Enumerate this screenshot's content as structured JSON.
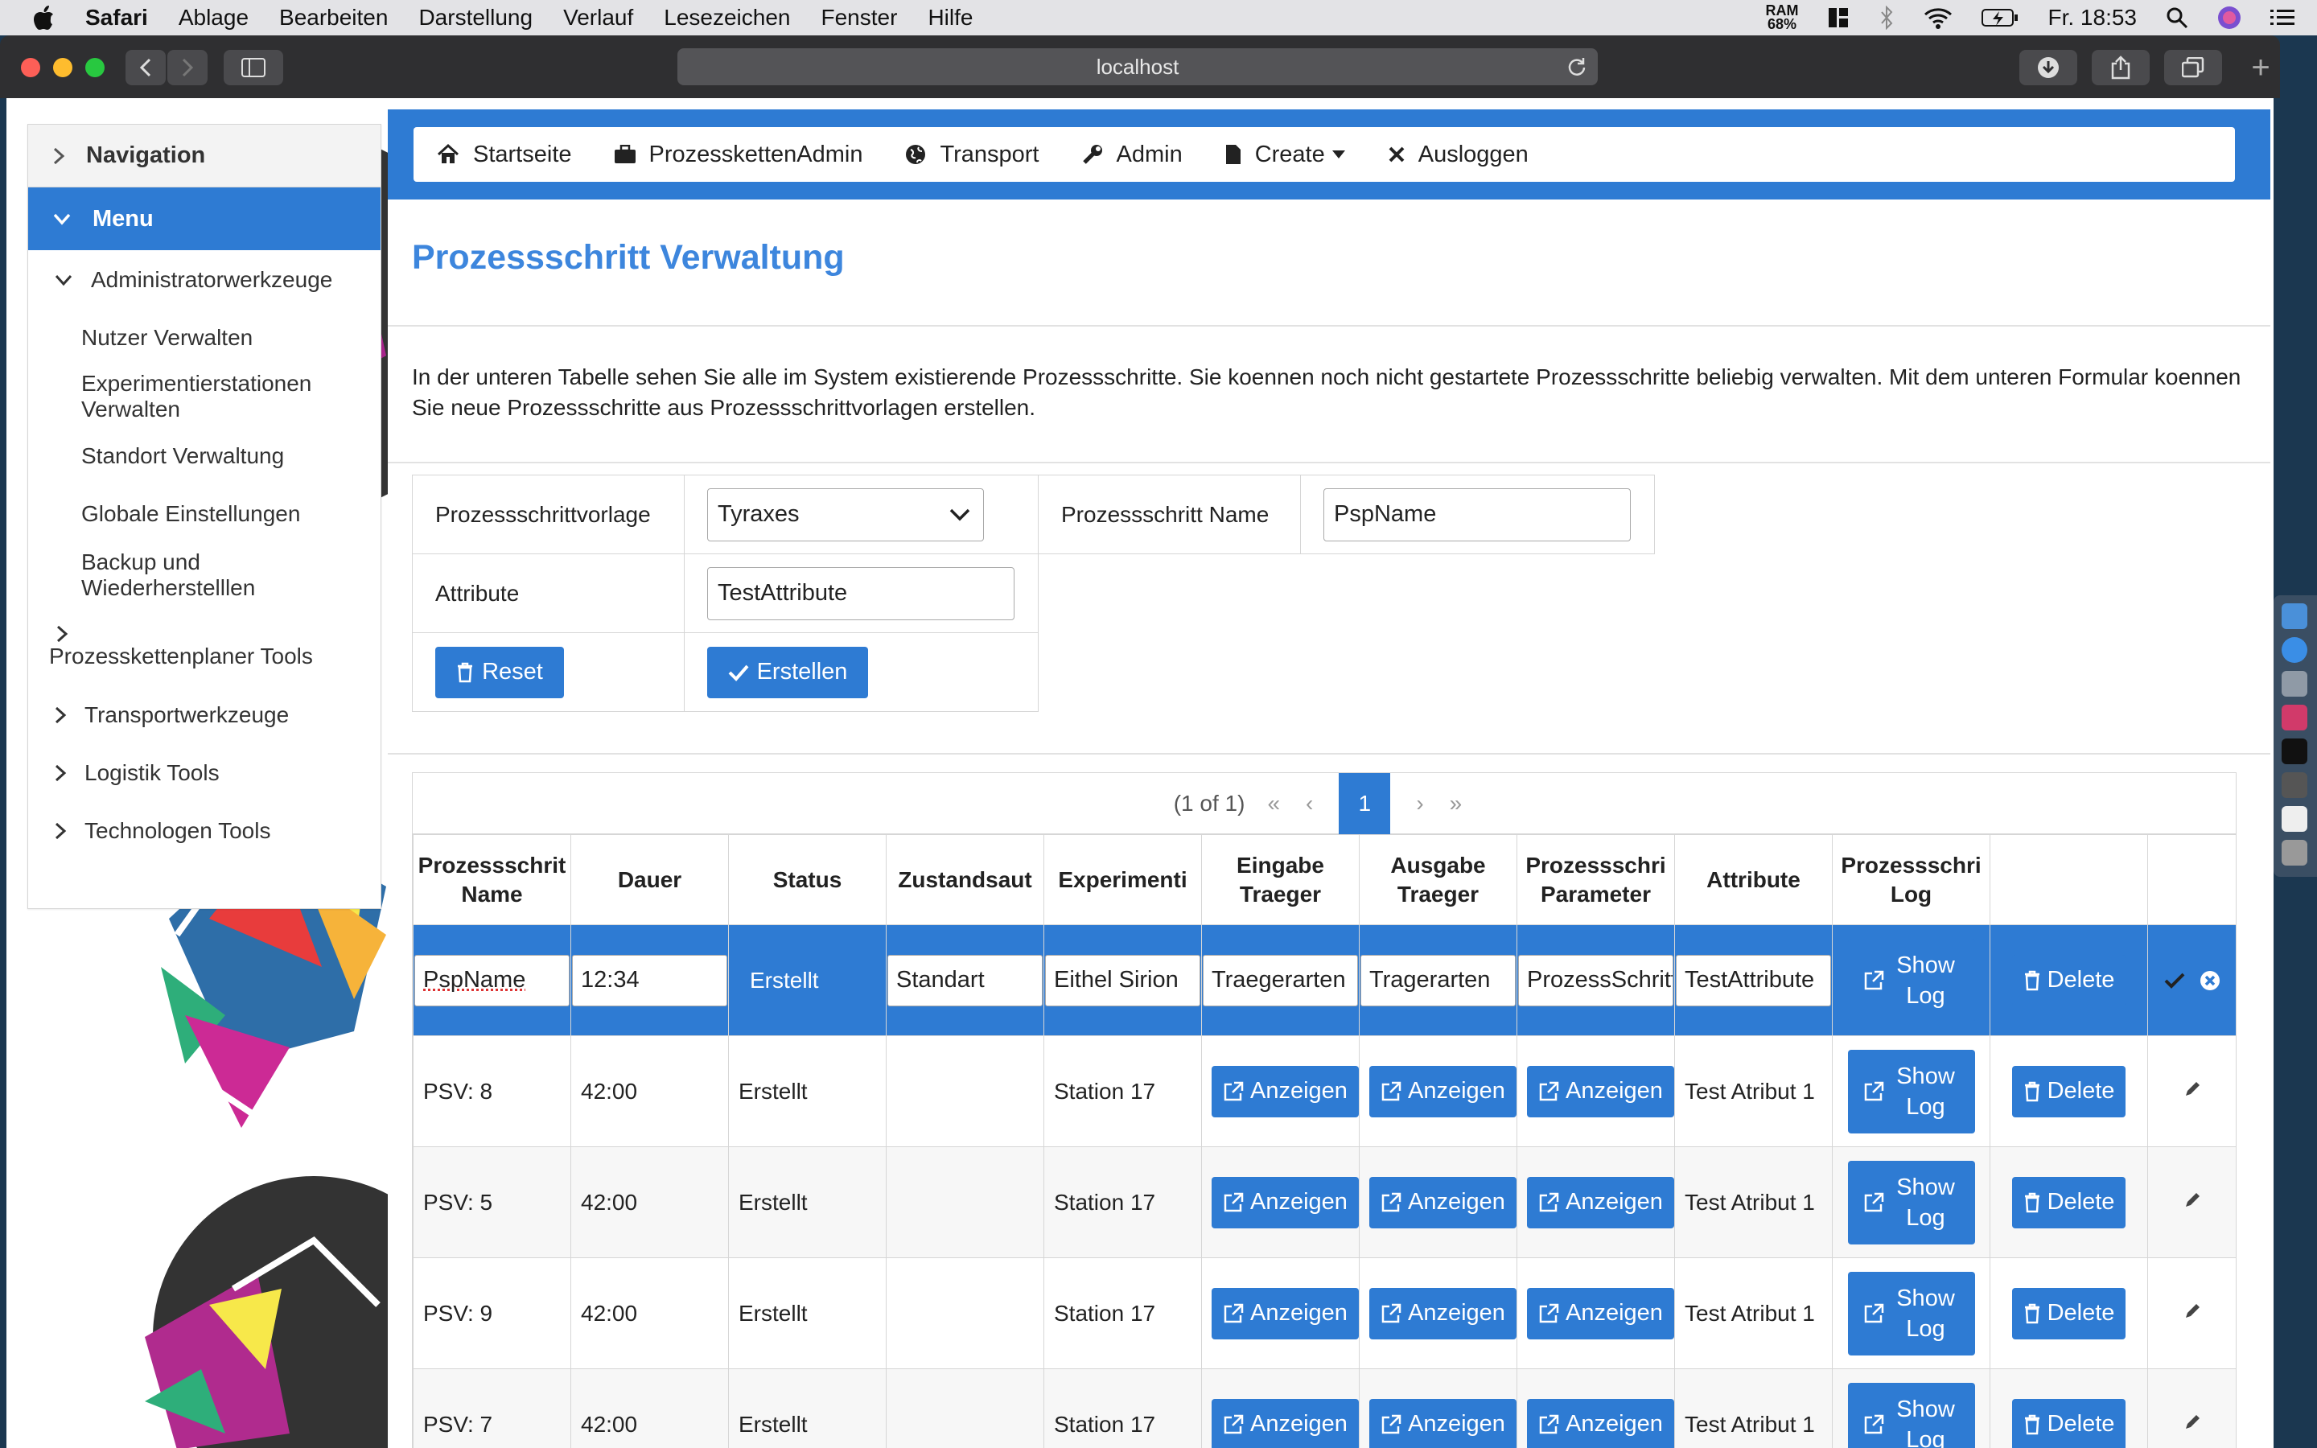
{
  "menubar": {
    "app_name": "Safari",
    "items": [
      "Ablage",
      "Bearbeiten",
      "Darstellung",
      "Verlauf",
      "Lesezeichen",
      "Fenster",
      "Hilfe"
    ],
    "ram_label": "RAM",
    "ram_value": "68%",
    "clock": "Fr. 18:53"
  },
  "browser": {
    "url": "localhost"
  },
  "sidebar": {
    "header": "Navigation",
    "menu": "Menu",
    "admin_category": "Administratorwerkzeuge",
    "admin_items": [
      "Nutzer Verwalten",
      "Experimentierstationen Verwalten",
      "Standort Verwaltung",
      "Globale Einstellungen",
      "Backup und Wiederherstelllen"
    ],
    "categories": [
      "Prozesskettenplaner Tools",
      "Transportwerkzeuge",
      "Logistik Tools",
      "Technologen Tools"
    ]
  },
  "nav": {
    "items": [
      "Startseite",
      "ProzesskettenAdmin",
      "Transport",
      "Admin",
      "Create",
      "Ausloggen"
    ]
  },
  "page": {
    "title": "Prozessschritt Verwaltung",
    "description": "In der unteren Tabelle sehen Sie alle im System existierende Prozessschritte. Sie koennen noch nicht gestartete Prozessschritte beliebig verwalten. Mit dem unteren Formular koennen Sie neue Prozessschritte aus Prozessschrittvorlagen erstellen."
  },
  "form": {
    "template_label": "Prozessschrittvorlage",
    "template_value": "Tyraxes",
    "name_label": "Prozessschritt Name",
    "name_value": "PspName",
    "attribute_label": "Attribute",
    "attribute_value": "TestAttribute",
    "reset_label": "Reset",
    "create_label": "Erstellen"
  },
  "pager": {
    "info": "(1 of 1)",
    "first": "«",
    "prev": "‹",
    "current": "1",
    "next": "›",
    "last": "»"
  },
  "table": {
    "headers": [
      "Prozessschrit Name",
      "Dauer",
      "Status",
      "Zustandsaut",
      "Experimenti",
      "Eingabe Traeger",
      "Ausgabe Traeger",
      "Prozessschri Parameter",
      "Attribute",
      "Prozessschri Log",
      ""
    ],
    "edit_row": {
      "name": "PspName",
      "duration": "12:34",
      "status": "Erstellt",
      "state": "Standart",
      "station": "Eithel Sirion",
      "input_carrier": "Traegerarten",
      "output_carrier": "Tragerarten",
      "parameter": "ProzessSchritt",
      "attribute": "TestAttribute",
      "log": "Show Log",
      "delete": "Delete"
    },
    "rows": [
      {
        "name": "PSV: 8",
        "duration": "42:00",
        "status": "Erstellt",
        "station": "Station 17",
        "attribute": "Test Atribut 1"
      },
      {
        "name": "PSV: 5",
        "duration": "42:00",
        "status": "Erstellt",
        "station": "Station 17",
        "attribute": "Test Atribut 1"
      },
      {
        "name": "PSV: 9",
        "duration": "42:00",
        "status": "Erstellt",
        "station": "Station 17",
        "attribute": "Test Atribut 1"
      },
      {
        "name": "PSV: 7",
        "duration": "42:00",
        "status": "Erstellt",
        "station": "Station 17",
        "attribute": "Test Atribut 1"
      }
    ],
    "show_label": "Anzeigen",
    "log_label": "Show Log",
    "delete_label": "Delete"
  },
  "colors": {
    "primary": "#2e7bd3",
    "title": "#3d86dd"
  }
}
